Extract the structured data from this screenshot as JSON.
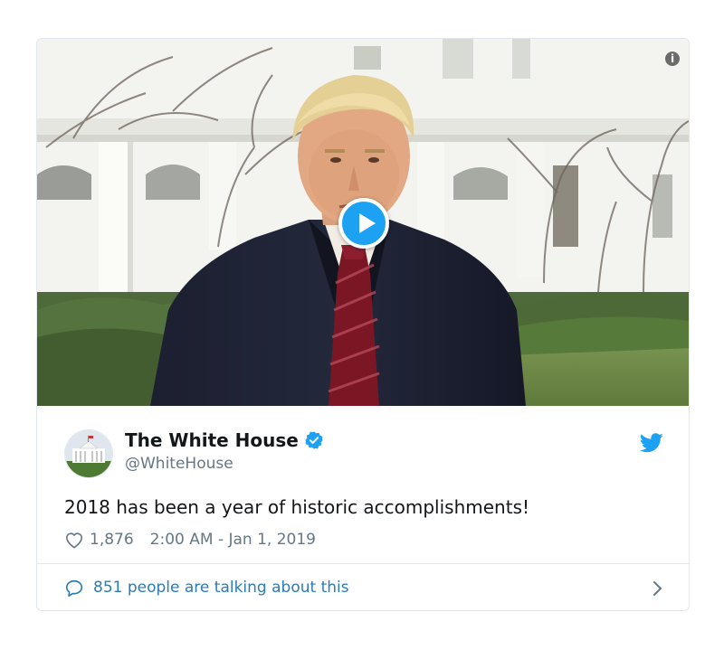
{
  "tweet": {
    "display_name": "The White House",
    "handle": "@WhiteHouse",
    "text": "2018 has been a year of historic accomplishments!",
    "likes": "1,876",
    "timestamp": "2:00 AM - Jan 1, 2019",
    "conversation": "851 people are talking about this"
  },
  "icons": {
    "info": "info-icon",
    "play": "play-icon",
    "verified": "verified-badge-icon",
    "twitter": "twitter-bird-icon",
    "like": "heart-icon",
    "conversation": "speech-bubble-icon",
    "chevron": "chevron-right-icon"
  },
  "colors": {
    "accent": "#1da1f2",
    "link": "#2b7bb9",
    "text": "#14171a",
    "muted": "#657786",
    "border": "#e1e8ed"
  }
}
